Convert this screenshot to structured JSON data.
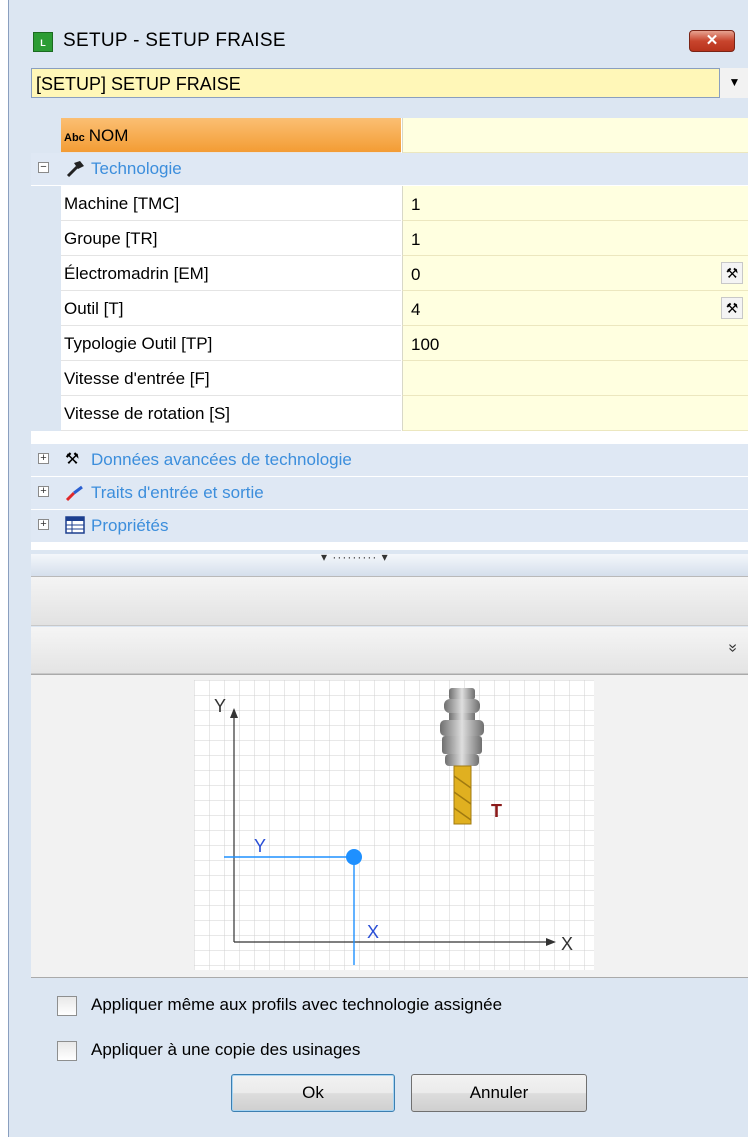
{
  "window": {
    "title": "SETUP - SETUP FRAISE",
    "app_icon_text": "L",
    "close_label": "✕"
  },
  "combo": {
    "selected": "[SETUP] SETUP FRAISE"
  },
  "grid": {
    "nom_icon_text": "Abc",
    "nom_label": "NOM",
    "nom_value": "",
    "technologie_label": "Technologie",
    "rows": [
      {
        "label": "Machine [TMC]",
        "value": "1"
      },
      {
        "label": "Groupe [TR]",
        "value": "1"
      },
      {
        "label": "Électromadrin [EM]",
        "value": "0"
      },
      {
        "label": "Outil [T]",
        "value": "4"
      },
      {
        "label": "Typologie Outil [TP]",
        "value": "100"
      },
      {
        "label": "Vitesse d'entrée [F]",
        "value": ""
      },
      {
        "label": "Vitesse de rotation [S]",
        "value": ""
      }
    ],
    "categories": [
      {
        "label": "Données avancées de technologie",
        "icon": "tools-icon"
      },
      {
        "label": "Traits d'entrée et sortie",
        "icon": "pen-icon"
      },
      {
        "label": "Propriétés",
        "icon": "table-icon"
      }
    ]
  },
  "splitter": {
    "glyph": "▾ ········· ▾"
  },
  "panel2": {
    "chevron": "»"
  },
  "preview": {
    "y_axis_label": "Y",
    "x_axis_label": "X",
    "y_marker_label": "Y",
    "x_marker_label": "X",
    "tool_label": "T",
    "colors": {
      "marker": "#1e90ff",
      "tool_label": "#8b1a1a",
      "tool_bit": "#e0b020"
    }
  },
  "options": {
    "apply_profiles": "Appliquer même aux profils avec technologie assignée",
    "apply_copy": "Appliquer à une copie des usinages"
  },
  "buttons": {
    "ok": "Ok",
    "cancel": "Annuler"
  }
}
